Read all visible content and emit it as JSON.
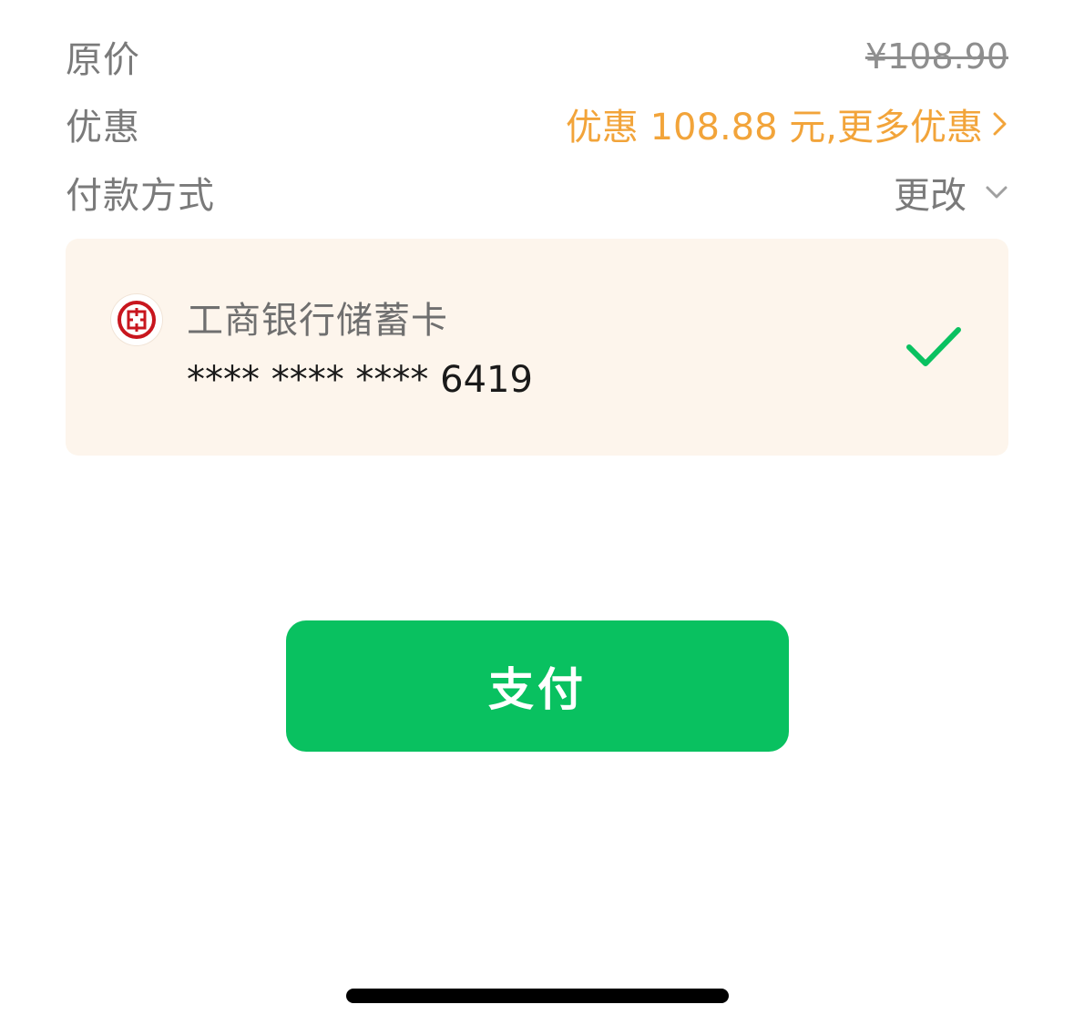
{
  "summary": {
    "original_price": {
      "label": "原价",
      "value": "¥108.90"
    },
    "discount": {
      "label": "优惠",
      "value": "优惠 108.88 元,更多优惠",
      "icon": "chevron-right-icon"
    },
    "payment_method": {
      "label": "付款方式",
      "change_label": "更改",
      "icon": "chevron-down-icon"
    }
  },
  "selected_card": {
    "bank_name": "工商银行储蓄卡",
    "card_number": "**** **** **** 6419",
    "logo_icon": "icbc-logo-icon",
    "selected_icon": "checkmark-icon"
  },
  "pay_button": {
    "label": "支付"
  },
  "colors": {
    "accent_green": "#09c160",
    "discount_orange": "#f2a43a",
    "card_panel_bg": "#fdf5ec",
    "bank_red": "#c8161e"
  }
}
